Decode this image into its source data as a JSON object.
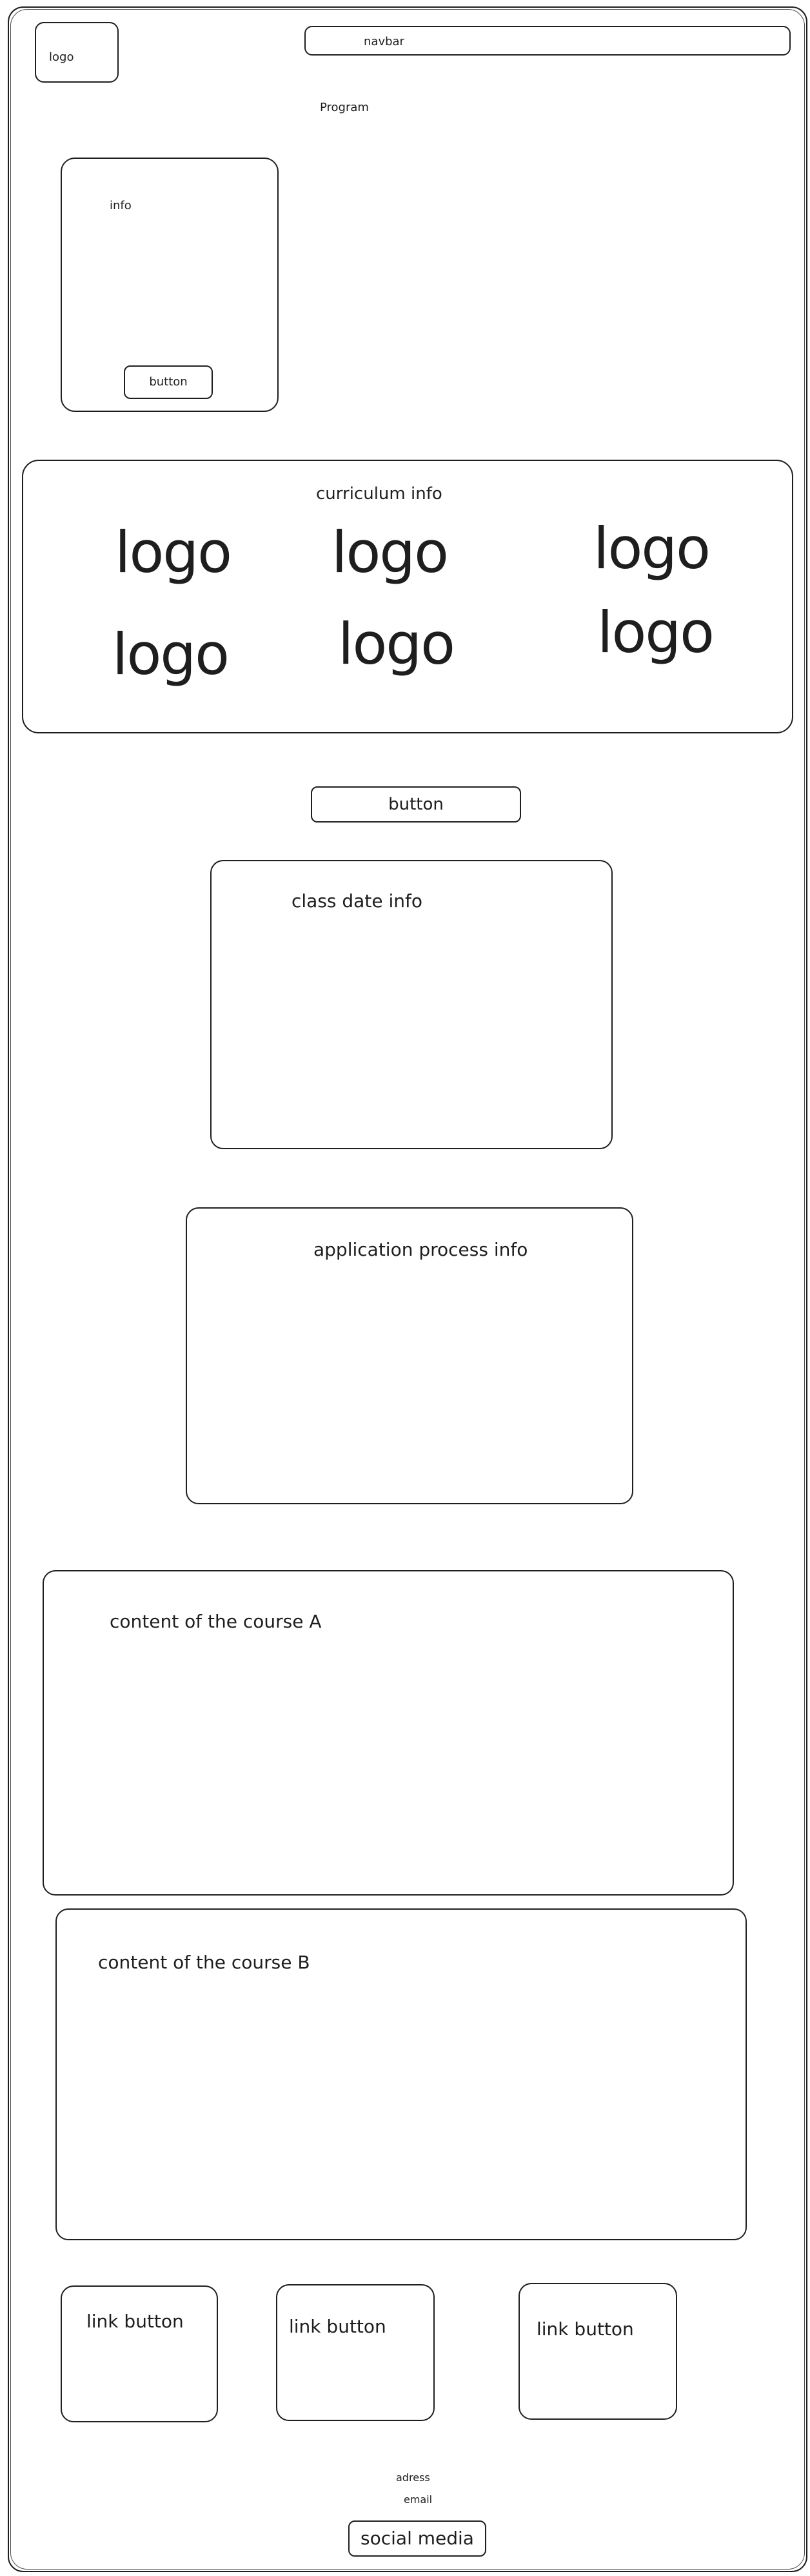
{
  "header": {
    "logo_label": "logo",
    "navbar_label": "navbar",
    "program_label": "Program"
  },
  "info_card": {
    "text": "info",
    "button_label": "button"
  },
  "curriculum": {
    "title": "curriculum info",
    "logos": [
      "logo",
      "logo",
      "logo",
      "logo",
      "logo",
      "logo"
    ]
  },
  "main_button": {
    "label": "button"
  },
  "class_date": {
    "title": "class date info"
  },
  "application": {
    "title": "application process info"
  },
  "course_a": {
    "title": "content of the course A"
  },
  "course_b": {
    "title": "content of the course B"
  },
  "link_buttons": [
    "link button",
    "link button",
    "link button"
  ],
  "footer": {
    "address": "adress",
    "email": "email",
    "social_label": "social media"
  }
}
